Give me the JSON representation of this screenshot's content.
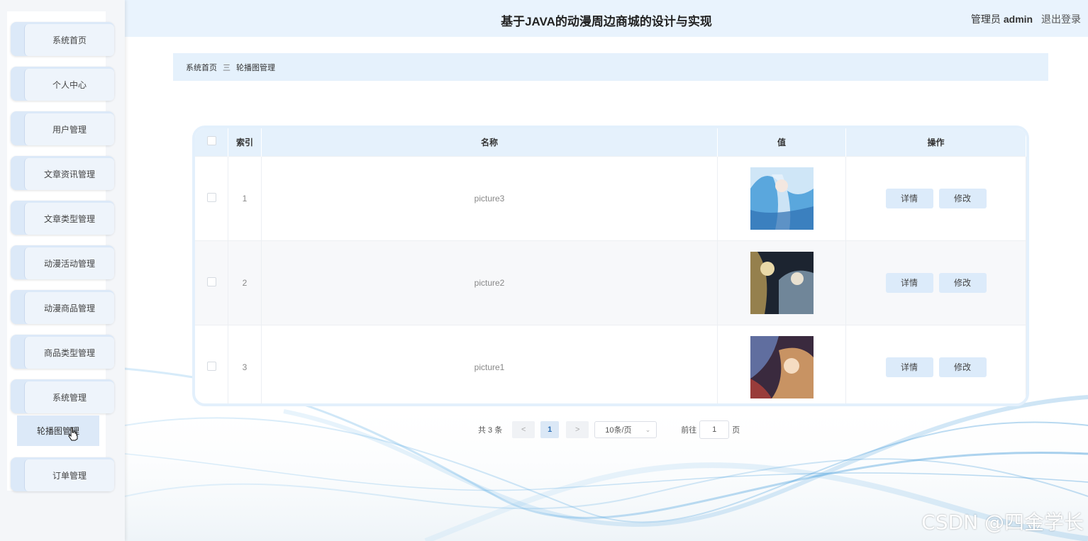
{
  "header": {
    "title": "基于JAVA的动漫周边商城的设计与实现",
    "role": "管理员",
    "username": "admin",
    "logout_label": "退出登录"
  },
  "sidebar": {
    "items": [
      {
        "label": "系统首页"
      },
      {
        "label": "个人中心"
      },
      {
        "label": "用户管理"
      },
      {
        "label": "文章资讯管理"
      },
      {
        "label": "文章类型管理"
      },
      {
        "label": "动漫活动管理"
      },
      {
        "label": "动漫商品管理"
      },
      {
        "label": "商品类型管理"
      },
      {
        "label": "系统管理"
      },
      {
        "label": "订单管理"
      }
    ],
    "submenu": {
      "label": "轮播图管理"
    }
  },
  "breadcrumb": {
    "home": "系统首页",
    "separator": "三",
    "current": "轮播图管理"
  },
  "table": {
    "headers": {
      "index": "索引",
      "name": "名称",
      "value": "值",
      "actions": "操作"
    },
    "rows": [
      {
        "index": "1",
        "name": "picture3",
        "detail_label": "详情",
        "edit_label": "修改"
      },
      {
        "index": "2",
        "name": "picture2",
        "detail_label": "详情",
        "edit_label": "修改"
      },
      {
        "index": "3",
        "name": "picture1",
        "detail_label": "详情",
        "edit_label": "修改"
      }
    ]
  },
  "pagination": {
    "total": "共 3 条",
    "prev": "<",
    "current_page": "1",
    "next": ">",
    "page_size": "10条/页",
    "goto_prefix": "前往",
    "goto_value": "1",
    "goto_suffix": "页"
  },
  "watermark": "CSDN @四金学长",
  "colors": {
    "accent": "#dcebfa",
    "header_bg": "#e9f3fd",
    "wave": "#3a9bd9"
  }
}
